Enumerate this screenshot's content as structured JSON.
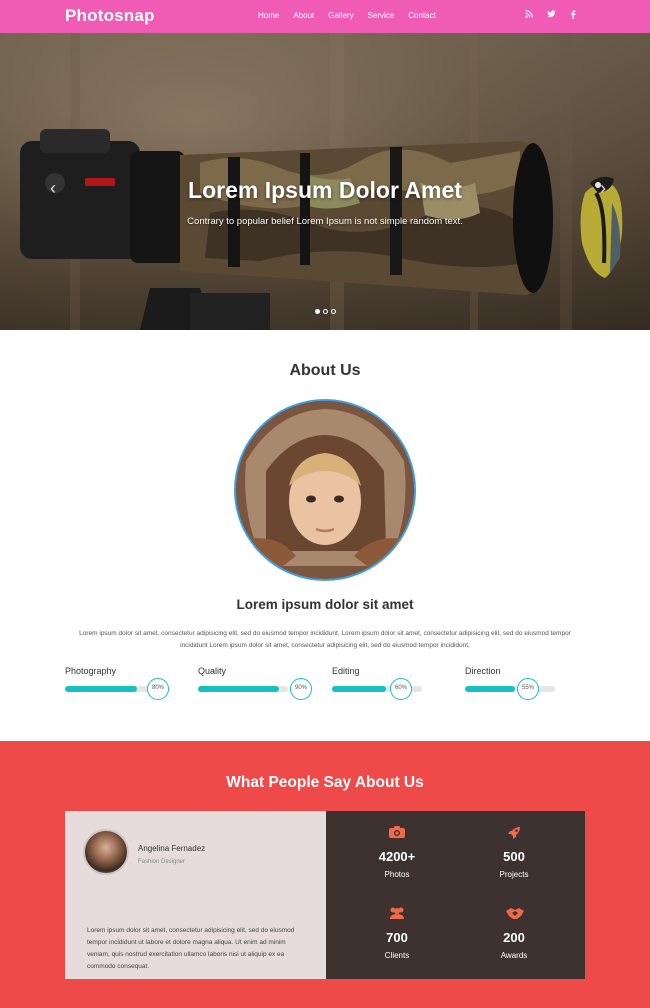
{
  "nav": {
    "brand": "Photosnap",
    "items": [
      {
        "label": "Home"
      },
      {
        "label": "About"
      },
      {
        "label": "Gallery"
      },
      {
        "label": "Service"
      },
      {
        "label": "Contact"
      }
    ],
    "social": [
      "rss-icon",
      "twitter-icon",
      "facebook-icon"
    ]
  },
  "hero": {
    "title": "Lorem Ipsum Dolor Amet",
    "subtitle": "Contrary to popular belief Lorem Ipsum is not simple random text.",
    "slides_total": 3,
    "active_slide": 1
  },
  "about": {
    "title": "About Us",
    "heading": "Lorem ipsum dolor sit amet",
    "text": "Lorem ipsum dolor sit amet, consectetur adipisicing elit, sed do eiusmod tempor incididunt, Lorem ipsum dolor sit amet, consectetur adipisicing elit, sed do eiusmod tempor incididunt Lorem ipsum dolor sit amet, consectetur adipisicing elit, sed do eiusmod tempor incididunt,",
    "skills": [
      {
        "label": "Photography",
        "value": 80,
        "display": "80%"
      },
      {
        "label": "Quality",
        "value": 90,
        "display": "90%"
      },
      {
        "label": "Editing",
        "value": 60,
        "display": "60%"
      },
      {
        "label": "Direction",
        "value": 55,
        "display": "55%"
      }
    ]
  },
  "testimonials": {
    "title": "What People Say About Us",
    "person": {
      "name": "Angelina Fernadez",
      "role": "Fashion Designer",
      "quote": "Lorem ipsum dolor sit amet, consectetur adipisicing elit, sed do eiusmod tempor incididunt ut labore et dolore magna aliqua. Ut enim ad minim veniam, quis nostrud exercitation ullamco laboris nisi ut aliquip ex ea commodo consequat."
    },
    "stats": [
      {
        "icon": "camera-icon",
        "value": "4200+",
        "label": "Photos"
      },
      {
        "icon": "rocket-icon",
        "value": "500",
        "label": "Projects"
      },
      {
        "icon": "users-icon",
        "value": "700",
        "label": "Clients"
      },
      {
        "icon": "handshake-icon",
        "value": "200",
        "label": "Awards"
      }
    ]
  },
  "colors": {
    "nav": "#f05cb5",
    "accent_teal": "#18c1c1",
    "testimonial_bg": "#ef4a4a",
    "stats_bg": "#3d3230",
    "stat_icon": "#f06a4a"
  }
}
